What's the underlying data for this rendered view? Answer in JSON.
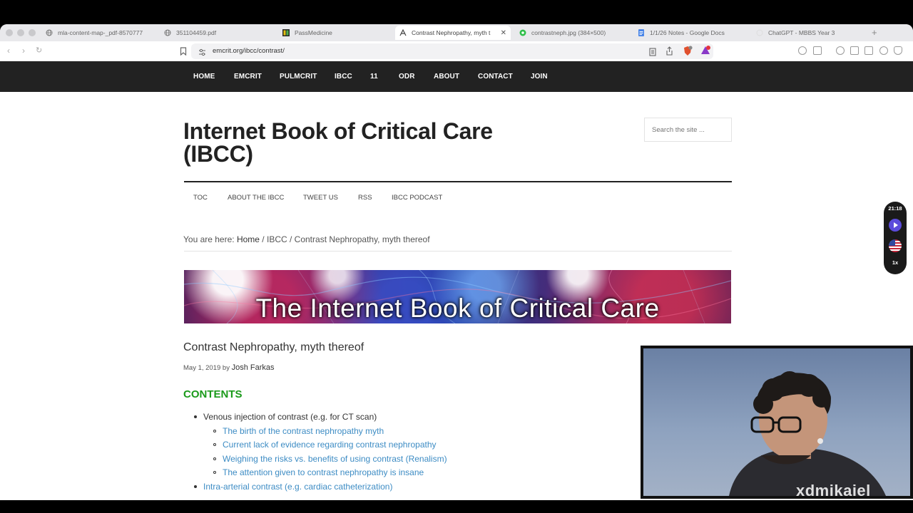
{
  "browser": {
    "tabs": [
      {
        "label": "mla-content-map-_pdf-8570777",
        "icon": "globe-icon"
      },
      {
        "label": "351104459.pdf",
        "icon": "globe-icon"
      },
      {
        "label": "PassMedicine",
        "icon": "passmedicine-icon"
      },
      {
        "label": "Contrast Nephropathy, myth t",
        "icon": "emcrit-icon",
        "active": true
      },
      {
        "label": "contrastneph.jpg (384×500)",
        "icon": "green-circle-icon"
      },
      {
        "label": "1/1/26 Notes - Google Docs",
        "icon": "docs-icon"
      },
      {
        "label": "ChatGPT - MBBS Year 3",
        "icon": "chatgpt-icon"
      }
    ],
    "url": "emcrit.org/ibcc/contrast/",
    "brave_badge": "9"
  },
  "site_nav": [
    "HOME",
    "EMCRIT",
    "PULMCRIT",
    "IBCC",
    "11",
    "ODR",
    "ABOUT",
    "CONTACT",
    "JOIN"
  ],
  "site": {
    "title": "Internet Book of Critical Care (IBCC)",
    "search_placeholder": "Search the site ...",
    "subnav": [
      "TOC",
      "ABOUT THE IBCC",
      "TWEET US",
      "RSS",
      "IBCC PODCAST"
    ]
  },
  "breadcrumb": {
    "prefix": "You are here: ",
    "home": "Home",
    "sep1": " / ",
    "section": "IBCC",
    "sep2": " / ",
    "current": "Contrast Nephropathy, myth thereof"
  },
  "banner": {
    "text": "The Internet Book of Critical Care"
  },
  "post": {
    "title": "Contrast Nephropathy, myth thereof",
    "date": "May 1, 2019",
    "by": " by ",
    "author": "Josh Farkas",
    "contents_heading": "CONTENTS",
    "toc": [
      {
        "text": "Venous injection of contrast (e.g. for CT scan)",
        "level": 1,
        "link": false
      },
      {
        "text": "The birth of the contrast nephropathy myth",
        "level": 2,
        "link": true
      },
      {
        "text": "Current lack of evidence regarding contrast nephropathy",
        "level": 2,
        "link": true
      },
      {
        "text": "Weighing the risks vs. benefits of using contrast (Renalism)",
        "level": 2,
        "link": true
      },
      {
        "text": "The attention given to contrast nephropathy is insane",
        "level": 2,
        "link": true
      },
      {
        "text": "Intra-arterial contrast (e.g. cardiac catheterization)",
        "level": 1,
        "link": true
      }
    ]
  },
  "widget": {
    "time": "21:18",
    "speed": "1x"
  },
  "webcam": {
    "username": "xdmikaiel"
  },
  "colors": {
    "nav_bg": "#222222",
    "contents_green": "#1a9a1a",
    "link_blue": "#3d8cc4"
  }
}
